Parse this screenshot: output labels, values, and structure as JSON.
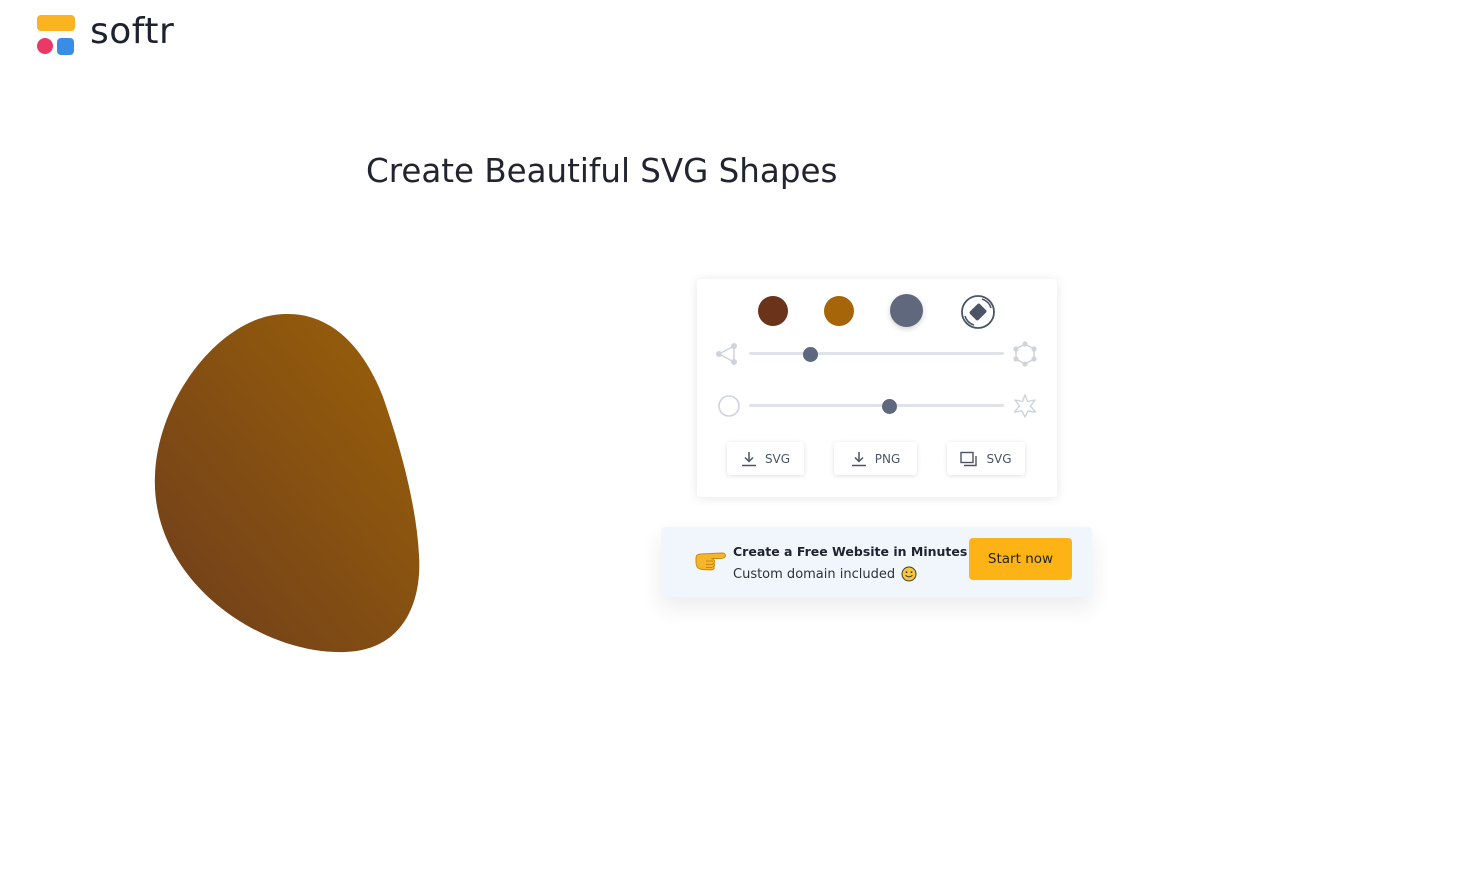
{
  "brand": {
    "name": "softr"
  },
  "hero": {
    "title": "Create Beautiful SVG Shapes"
  },
  "shape": {
    "gradient_start": "#6e3d1c",
    "gradient_end": "#9b6108"
  },
  "controls": {
    "swatches": [
      {
        "color": "#6b3319",
        "selected": false
      },
      {
        "color": "#a56508",
        "selected": false
      },
      {
        "color": "#5f687d",
        "selected": true
      }
    ],
    "random_icon": "random-shape-icon",
    "complexity": {
      "min_icon": "few-points-icon",
      "max_icon": "many-points-icon",
      "value": 0.24
    },
    "contrast": {
      "min_icon": "circle-icon",
      "max_icon": "spiky-star-icon",
      "value": 0.55
    },
    "buttons": [
      {
        "label": "SVG",
        "icon": "download-icon"
      },
      {
        "label": "PNG",
        "icon": "download-icon"
      },
      {
        "label": "SVG",
        "icon": "copy-icon"
      }
    ]
  },
  "promo": {
    "emoji": "pointing-hand-icon",
    "title": "Create a Free Website in Minutes",
    "subtitle": "Custom domain included",
    "subtitle_icon": "smiley-icon",
    "cta": "Start now",
    "accent": "#fdb316"
  }
}
